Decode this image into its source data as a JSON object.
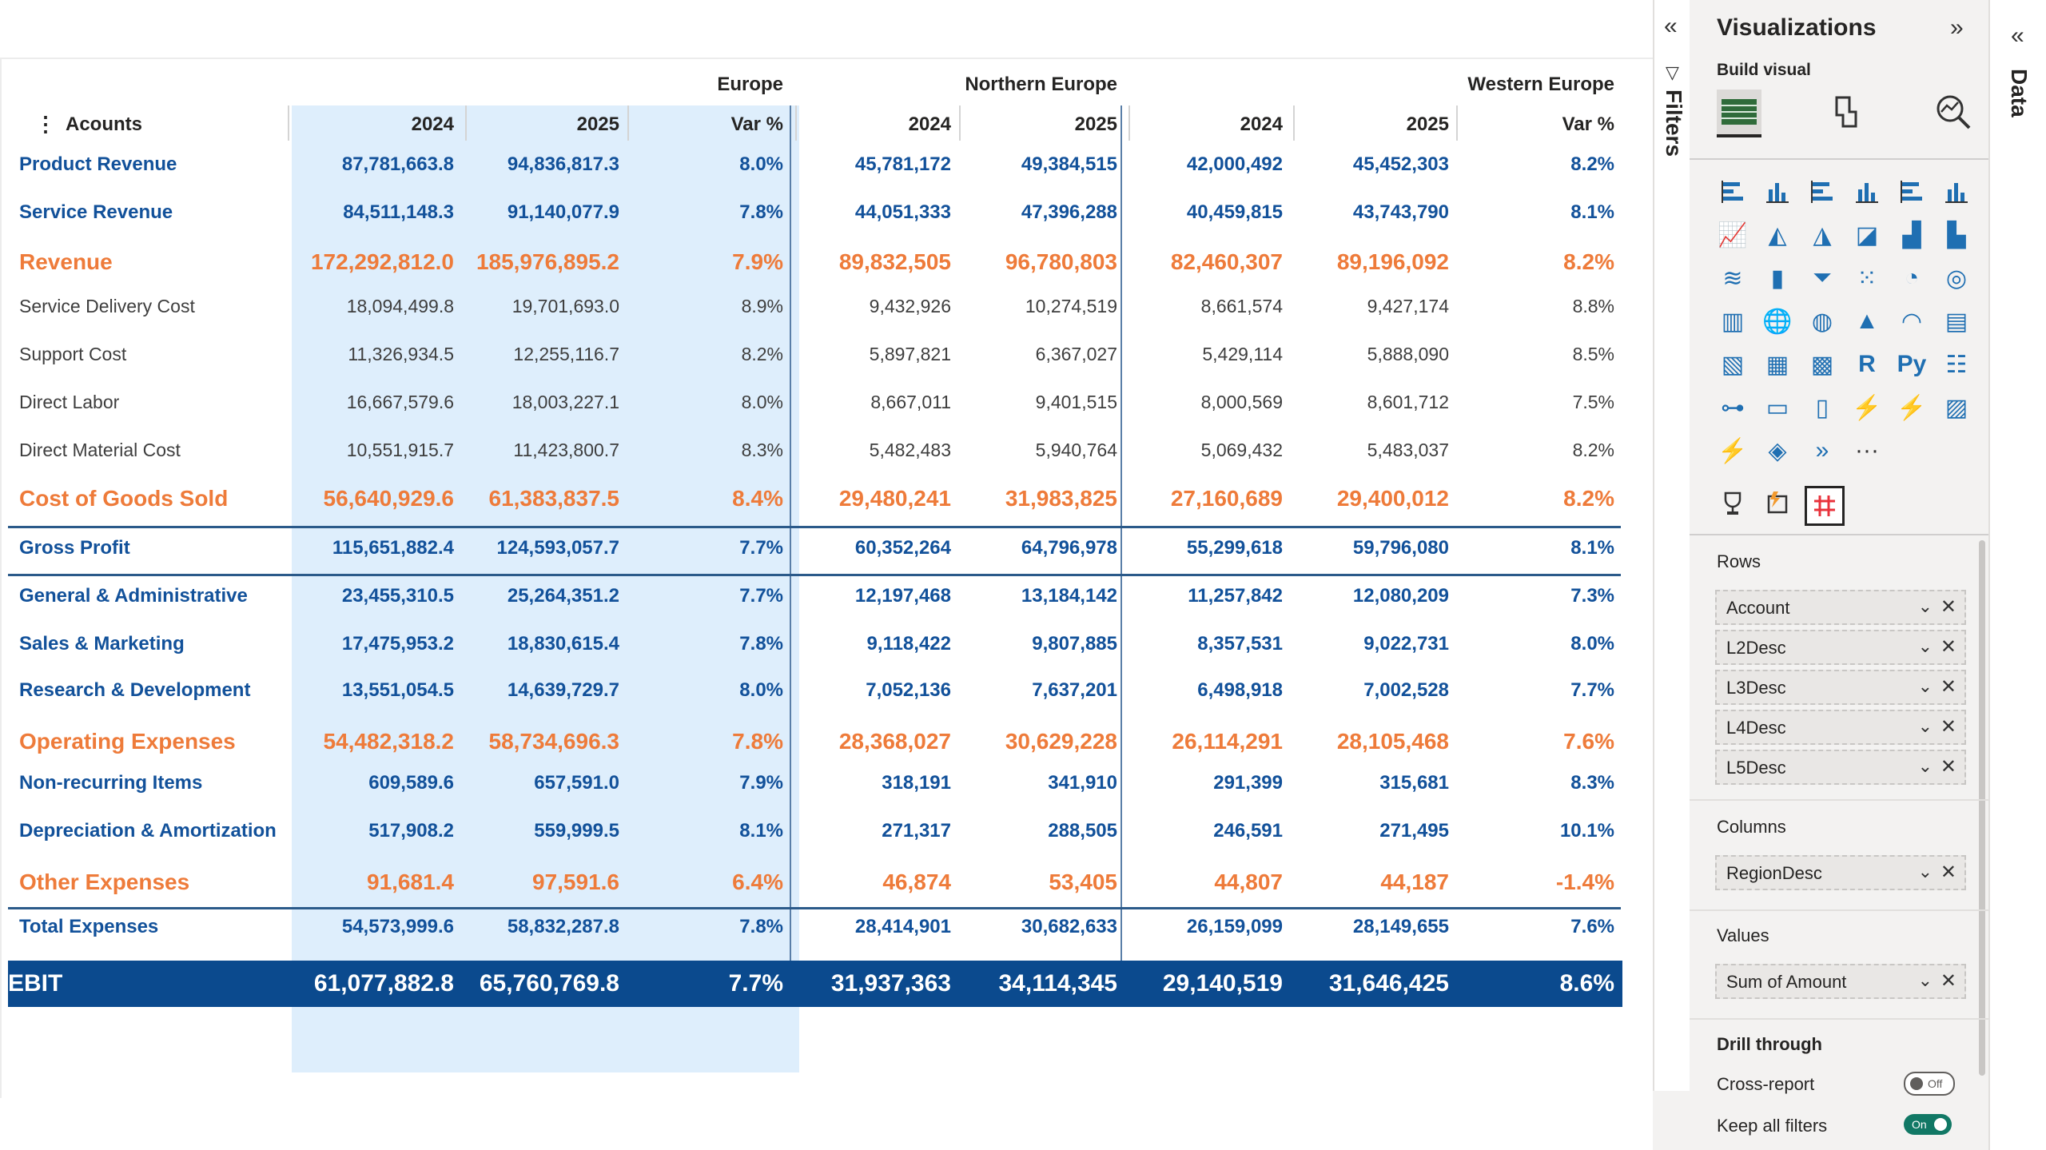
{
  "matrix": {
    "row_header": "Acounts",
    "regions": [
      "Europe",
      "Northern Europe",
      "Western Europe"
    ],
    "column_headers": [
      "2024",
      "2025",
      "Var %",
      "2024",
      "2025",
      "2024",
      "2025",
      "Var %"
    ],
    "rows": [
      {
        "label": "Product Revenue",
        "style": "blue",
        "values": [
          "87,781,663.8",
          "94,836,817.3",
          "8.0%",
          "45,781,172",
          "49,384,515",
          "42,000,492",
          "45,452,303",
          "8.2%"
        ]
      },
      {
        "label": "Service Revenue",
        "style": "blue",
        "values": [
          "84,511,148.3",
          "91,140,077.9",
          "7.8%",
          "44,051,333",
          "47,396,288",
          "40,459,815",
          "43,743,790",
          "8.1%"
        ]
      },
      {
        "label": "Revenue",
        "style": "orange",
        "values": [
          "172,292,812.0",
          "185,976,895.2",
          "7.9%",
          "89,832,505",
          "96,780,803",
          "82,460,307",
          "89,196,092",
          "8.2%"
        ]
      },
      {
        "label": "Service Delivery Cost",
        "style": "gray",
        "values": [
          "18,094,499.8",
          "19,701,693.0",
          "8.9%",
          "9,432,926",
          "10,274,519",
          "8,661,574",
          "9,427,174",
          "8.8%"
        ]
      },
      {
        "label": "Support Cost",
        "style": "gray",
        "values": [
          "11,326,934.5",
          "12,255,116.7",
          "8.2%",
          "5,897,821",
          "6,367,027",
          "5,429,114",
          "5,888,090",
          "8.5%"
        ]
      },
      {
        "label": "Direct Labor",
        "style": "gray",
        "values": [
          "16,667,579.6",
          "18,003,227.1",
          "8.0%",
          "8,667,011",
          "9,401,515",
          "8,000,569",
          "8,601,712",
          "7.5%"
        ]
      },
      {
        "label": "Direct Material Cost",
        "style": "gray",
        "values": [
          "10,551,915.7",
          "11,423,800.7",
          "8.3%",
          "5,482,483",
          "5,940,764",
          "5,069,432",
          "5,483,037",
          "8.2%"
        ]
      },
      {
        "label": "Cost of Goods Sold",
        "style": "orange",
        "values": [
          "56,640,929.6",
          "61,383,837.5",
          "8.4%",
          "29,480,241",
          "31,983,825",
          "27,160,689",
          "29,400,012",
          "8.2%"
        ]
      },
      {
        "label": "Gross Profit",
        "style": "total",
        "values": [
          "115,651,882.4",
          "124,593,057.7",
          "7.7%",
          "60,352,264",
          "64,796,978",
          "55,299,618",
          "59,796,080",
          "8.1%"
        ]
      },
      {
        "label": "General & Administrative",
        "style": "blue",
        "values": [
          "23,455,310.5",
          "25,264,351.2",
          "7.7%",
          "12,197,468",
          "13,184,142",
          "11,257,842",
          "12,080,209",
          "7.3%"
        ]
      },
      {
        "label": "Sales & Marketing",
        "style": "blue",
        "values": [
          "17,475,953.2",
          "18,830,615.4",
          "7.8%",
          "9,118,422",
          "9,807,885",
          "8,357,531",
          "9,022,731",
          "8.0%"
        ]
      },
      {
        "label": "Research & Development",
        "style": "blue",
        "values": [
          "13,551,054.5",
          "14,639,729.7",
          "8.0%",
          "7,052,136",
          "7,637,201",
          "6,498,918",
          "7,002,528",
          "7.7%"
        ]
      },
      {
        "label": "Operating Expenses",
        "style": "orange",
        "values": [
          "54,482,318.2",
          "58,734,696.3",
          "7.8%",
          "28,368,027",
          "30,629,228",
          "26,114,291",
          "28,105,468",
          "7.6%"
        ]
      },
      {
        "label": "Non-recurring Items",
        "style": "blue",
        "values": [
          "609,589.6",
          "657,591.0",
          "7.9%",
          "318,191",
          "341,910",
          "291,399",
          "315,681",
          "8.3%"
        ]
      },
      {
        "label": "Depreciation & Amortization",
        "style": "blue",
        "values": [
          "517,908.2",
          "559,999.5",
          "8.1%",
          "271,317",
          "288,505",
          "246,591",
          "271,495",
          "10.1%"
        ]
      },
      {
        "label": "Other Expenses",
        "style": "orange",
        "values": [
          "91,681.4",
          "97,591.6",
          "6.4%",
          "46,874",
          "53,405",
          "44,807",
          "44,187",
          "-1.4%"
        ]
      },
      {
        "label": "Total Expenses",
        "style": "total",
        "values": [
          "54,573,999.6",
          "58,832,287.8",
          "7.8%",
          "28,414,901",
          "30,682,633",
          "26,159,099",
          "28,149,655",
          "7.6%"
        ]
      }
    ],
    "ebit": {
      "label": "EBIT",
      "values": [
        "61,077,882.8",
        "65,760,769.8",
        "7.7%",
        "31,937,363",
        "34,114,345",
        "29,140,519",
        "31,646,425",
        "8.6%"
      ]
    },
    "colors": {
      "blue_text": "#12519a",
      "orange_text": "#ee7b3a",
      "europe_band": "#deeefc",
      "ebit_bg": "#0b4a8e"
    }
  },
  "filters_pane": {
    "title": "Filters",
    "collapse_icon": "double-chevron-left-icon",
    "filter_icon": "funnel-icon"
  },
  "visualizations_pane": {
    "title": "Visualizations",
    "collapse_icon": "double-chevron-right-icon",
    "build_visual_label": "Build visual",
    "mode_icons": [
      "build-visual-icon",
      "format-visual-icon",
      "analytics-icon"
    ],
    "visual_icons": [
      "stacked-bar-icon",
      "stacked-column-icon",
      "clustered-bar-icon",
      "clustered-column-icon",
      "100-stacked-bar-icon",
      "100-stacked-column-icon",
      "line-chart-icon",
      "area-chart-icon",
      "stacked-area-icon",
      "100-stacked-area-icon",
      "line-stacked-column-icon",
      "line-clustered-column-icon",
      "ribbon-chart-icon",
      "waterfall-icon",
      "funnel-chart-icon",
      "scatter-icon",
      "pie-chart-icon",
      "donut-chart-icon",
      "treemap-icon",
      "map-icon",
      "filled-map-icon",
      "azure-map-icon",
      "gauge-icon",
      "card-icon",
      "kpi-icon",
      "table-icon",
      "matrix-icon",
      "r-visual-icon",
      "python-visual-icon",
      "key-influencers-icon",
      "decomposition-tree-icon",
      "qa-icon",
      "paginated-report-icon",
      "smart-narrative-icon",
      "power-apps-icon",
      "image-icon",
      "power-automate-icon",
      "diamond-visual-icon",
      "chevrons-visual-icon",
      "more-visuals-icon"
    ],
    "r_label": "R",
    "py_label": "Py",
    "more_label": "···",
    "custom_visual_icons": [
      "trophy-icon",
      "custom-report-icon",
      "matrix-grid-icon"
    ],
    "rows_label": "Rows",
    "rows_fields": [
      "Account",
      "L2Desc",
      "L3Desc",
      "L4Desc",
      "L5Desc"
    ],
    "columns_label": "Columns",
    "columns_fields": [
      "RegionDesc"
    ],
    "values_label": "Values",
    "values_fields": [
      "Sum of Amount"
    ],
    "drill_through_label": "Drill through",
    "cross_report_label": "Cross-report",
    "cross_report_state": "Off",
    "keep_filters_label": "Keep all filters",
    "keep_filters_state": "On"
  },
  "data_pane": {
    "title": "Data",
    "collapse_icon": "double-chevron-left-icon"
  }
}
